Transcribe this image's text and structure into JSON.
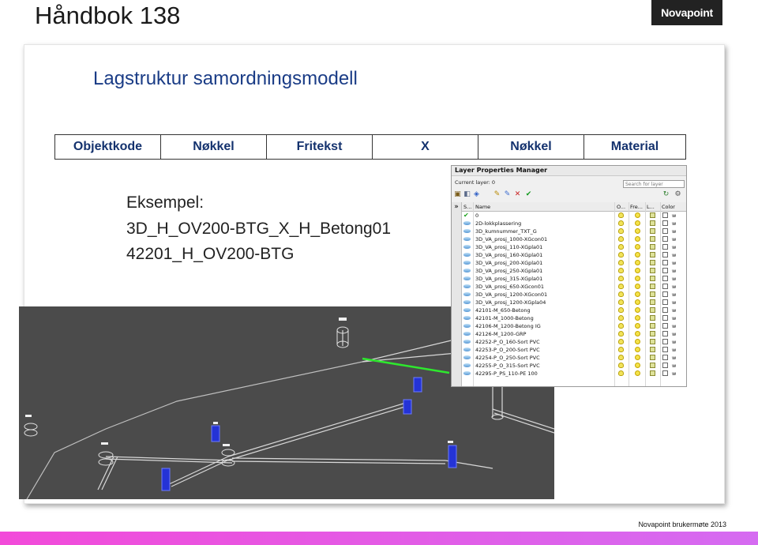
{
  "slide": {
    "title": "Håndbok 138",
    "logo": "Novapoint"
  },
  "card": {
    "title": "Lagstruktur samordningsmodell",
    "table_headers": [
      "Objektkode",
      "Nøkkel",
      "Fritekst",
      "X",
      "Nøkkel",
      "Material"
    ],
    "example_lines": [
      "Eksempel:",
      "3D_H_OV200-BTG_X_H_Betong01",
      "42201_H_OV200-BTG"
    ]
  },
  "layer_manager": {
    "title": "Layer Properties Manager",
    "current_layer": "Current layer: 0",
    "search_placeholder": "Search for layer",
    "left_collapse": "»",
    "columns": [
      "S...",
      "Name",
      "O...",
      "Fre...",
      "L...",
      "Color"
    ],
    "layers": [
      {
        "name": "0",
        "color": "w",
        "current": true
      },
      {
        "name": "2D-lokkplassering",
        "color": "w"
      },
      {
        "name": "3D_kumnummer_TXT_G",
        "color": "w"
      },
      {
        "name": "3D_VA_prosj_1000-XGcon01",
        "color": "w"
      },
      {
        "name": "3D_VA_prosj_110-XGpla01",
        "color": "w"
      },
      {
        "name": "3D_VA_prosj_160-XGpla01",
        "color": "w"
      },
      {
        "name": "3D_VA_prosj_200-XGpla01",
        "color": "w"
      },
      {
        "name": "3D_VA_prosj_250-XGpla01",
        "color": "w"
      },
      {
        "name": "3D_VA_prosj_315-XGpla01",
        "color": "w"
      },
      {
        "name": "3D_VA_prosj_650-XGcon01",
        "color": "w"
      },
      {
        "name": "3D_VA_prosj_1200-XGcon01",
        "color": "w"
      },
      {
        "name": "3D_VA_prosj_1200-XGpla04",
        "color": "w"
      },
      {
        "name": "42101-M_650-Betong",
        "color": "w"
      },
      {
        "name": "42101-M_1000-Betong",
        "color": "w"
      },
      {
        "name": "42106-M_1200-Betong IG",
        "color": "w"
      },
      {
        "name": "42126-M_1200-GRP",
        "color": "w"
      },
      {
        "name": "42252-P_O_160-Sort PVC",
        "color": "w"
      },
      {
        "name": "42253-P_O_200-Sort PVC",
        "color": "w"
      },
      {
        "name": "42254-P_O_250-Sort PVC",
        "color": "w"
      },
      {
        "name": "42255-P_O_315-Sort PVC",
        "color": "w"
      },
      {
        "name": "42295-P_PS_110-PE 100",
        "color": "w"
      }
    ]
  },
  "footer": {
    "text": "Novapoint brukermøte 2013"
  },
  "colors": {
    "accent_bar": "#f24ad9",
    "header_text": "#14326e",
    "viewport_bg": "#4b4b4b",
    "selected_line": "#2ee82e",
    "pipe_blue": "#2433d6"
  }
}
